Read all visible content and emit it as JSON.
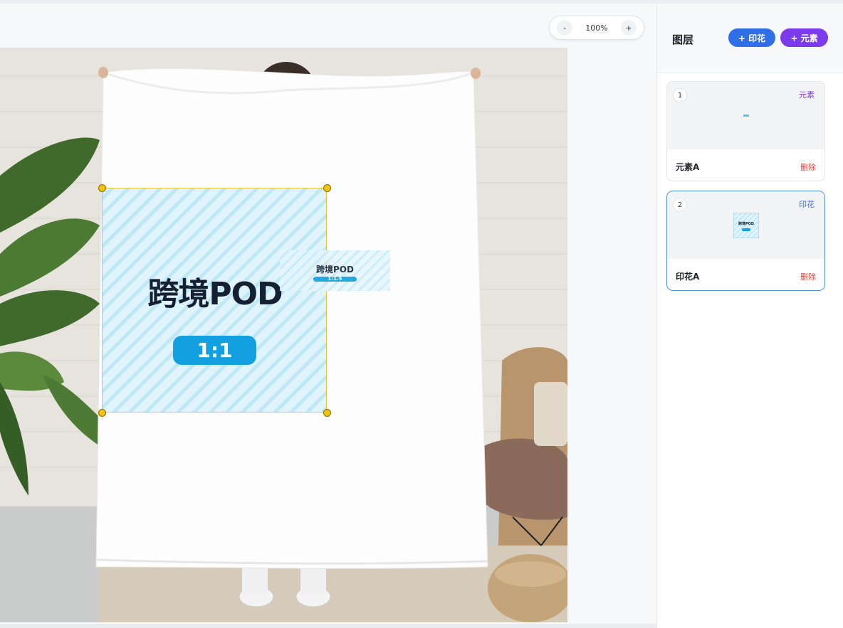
{
  "zoom": {
    "decrease": "-",
    "value": "100%",
    "increase": "+"
  },
  "canvas": {
    "print": {
      "title": "跨境POD",
      "ratio": "1:1"
    },
    "element": {
      "title": "跨境POD",
      "ratio": "1:1.5"
    }
  },
  "sidebar": {
    "title": "图层",
    "add_print": "+ 印花",
    "add_element": "+ 元素",
    "layers": [
      {
        "index": "1",
        "type": "元素",
        "type_color": "#7c3aed",
        "name": "元素A",
        "delete": "删除"
      },
      {
        "index": "2",
        "type": "印花",
        "type_color": "#2f6ee6",
        "name": "印花A",
        "delete": "删除"
      }
    ]
  },
  "colors": {
    "accent_blue": "#2f6ee6",
    "accent_purple": "#7c3aed",
    "selection": "#e4c53a",
    "delete": "#e0483e"
  }
}
